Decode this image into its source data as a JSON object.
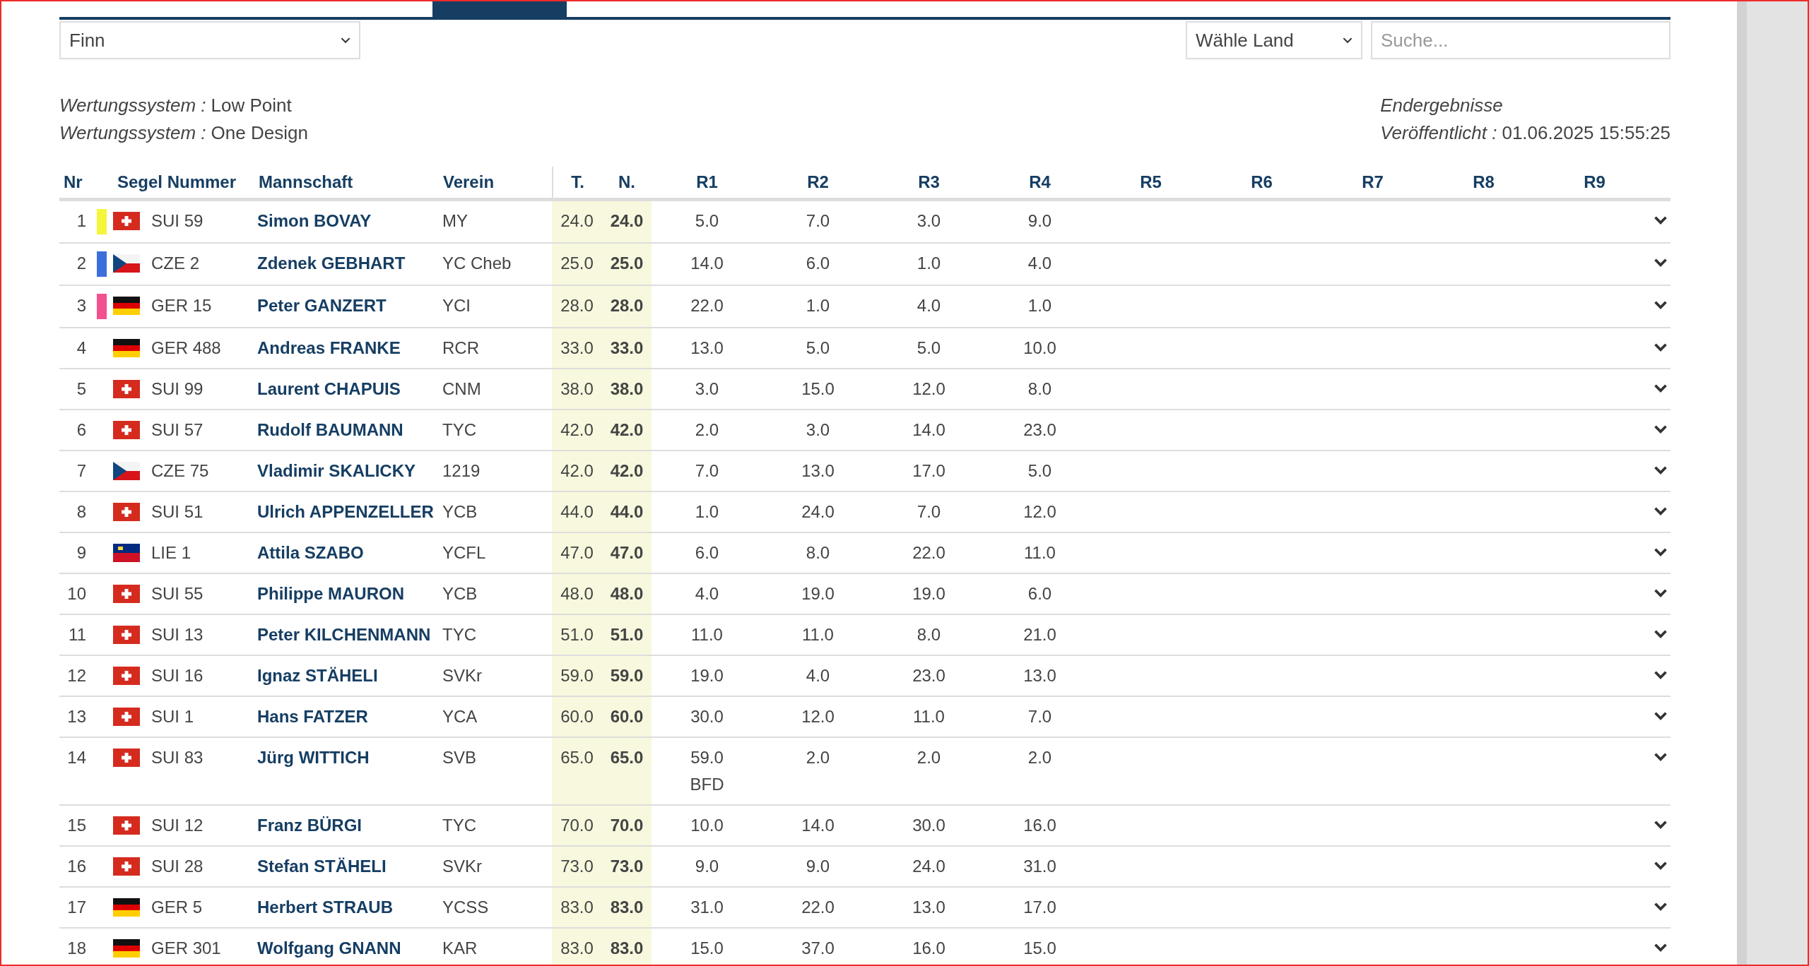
{
  "class_select": {
    "value": "Finn"
  },
  "country_select": {
    "value": "Wähle Land"
  },
  "search": {
    "placeholder": "Suche..."
  },
  "info_left": [
    {
      "label": "Wertungssystem :",
      "value": "Low Point"
    },
    {
      "label": "Wertungssystem :",
      "value": "One Design"
    }
  ],
  "info_right": {
    "status": "Endergebnisse",
    "published_label": "Veröffentlicht :",
    "published_value": "01.06.2025 15:55:25"
  },
  "table": {
    "columns": [
      "Nr",
      "Segel Nummer",
      "Mannschaft",
      "Verein",
      "T.",
      "N.",
      "R1",
      "R2",
      "R3",
      "R4",
      "R5",
      "R6",
      "R7",
      "R8",
      "R9"
    ],
    "rows": [
      {
        "nr": "1",
        "color": "#f5f53c",
        "flag": {
          "kind": "sui"
        },
        "sail": "SUI 59",
        "name": "Simon BOVAY",
        "club": "MY",
        "total": "24.0",
        "net": "24.0",
        "races": [
          {
            "score": "5.0"
          },
          {
            "score": "7.0"
          },
          {
            "score": "3.0"
          },
          {
            "score": "9.0"
          }
        ]
      },
      {
        "nr": "2",
        "color": "#3d6fdc",
        "flag": {
          "kind": "cze"
        },
        "sail": "CZE 2",
        "name": "Zdenek GEBHART",
        "club": "YC Cheb",
        "total": "25.0",
        "net": "25.0",
        "races": [
          {
            "score": "14.0"
          },
          {
            "score": "6.0"
          },
          {
            "score": "1.0"
          },
          {
            "score": "4.0"
          }
        ]
      },
      {
        "nr": "3",
        "color": "#f2508e",
        "flag": {
          "kind": "ger"
        },
        "sail": "GER 15",
        "name": "Peter GANZERT",
        "club": "YCI",
        "total": "28.0",
        "net": "28.0",
        "races": [
          {
            "score": "22.0"
          },
          {
            "score": "1.0"
          },
          {
            "score": "4.0"
          },
          {
            "score": "1.0"
          }
        ]
      },
      {
        "nr": "4",
        "flag": {
          "kind": "ger"
        },
        "sail": "GER 488",
        "name": "Andreas FRANKE",
        "club": "RCR",
        "total": "33.0",
        "net": "33.0",
        "races": [
          {
            "score": "13.0"
          },
          {
            "score": "5.0"
          },
          {
            "score": "5.0"
          },
          {
            "score": "10.0"
          }
        ]
      },
      {
        "nr": "5",
        "flag": {
          "kind": "sui"
        },
        "sail": "SUI 99",
        "name": "Laurent CHAPUIS",
        "club": "CNM",
        "total": "38.0",
        "net": "38.0",
        "races": [
          {
            "score": "3.0"
          },
          {
            "score": "15.0"
          },
          {
            "score": "12.0"
          },
          {
            "score": "8.0"
          }
        ]
      },
      {
        "nr": "6",
        "flag": {
          "kind": "sui"
        },
        "sail": "SUI 57",
        "name": "Rudolf BAUMANN",
        "club": "TYC",
        "total": "42.0",
        "net": "42.0",
        "races": [
          {
            "score": "2.0"
          },
          {
            "score": "3.0"
          },
          {
            "score": "14.0"
          },
          {
            "score": "23.0"
          }
        ]
      },
      {
        "nr": "7",
        "flag": {
          "kind": "cze"
        },
        "sail": "CZE 75",
        "name": "Vladimir SKALICKY",
        "club": "1219",
        "total": "42.0",
        "net": "42.0",
        "races": [
          {
            "score": "7.0"
          },
          {
            "score": "13.0"
          },
          {
            "score": "17.0"
          },
          {
            "score": "5.0"
          }
        ]
      },
      {
        "nr": "8",
        "flag": {
          "kind": "sui"
        },
        "sail": "SUI 51",
        "name": "Ulrich APPENZELLER",
        "club": "YCB",
        "total": "44.0",
        "net": "44.0",
        "races": [
          {
            "score": "1.0"
          },
          {
            "score": "24.0"
          },
          {
            "score": "7.0"
          },
          {
            "score": "12.0"
          }
        ]
      },
      {
        "nr": "9",
        "flag": {
          "kind": "lie"
        },
        "sail": "LIE 1",
        "name": "Attila SZABO",
        "club": "YCFL",
        "total": "47.0",
        "net": "47.0",
        "races": [
          {
            "score": "6.0"
          },
          {
            "score": "8.0"
          },
          {
            "score": "22.0"
          },
          {
            "score": "11.0"
          }
        ]
      },
      {
        "nr": "10",
        "flag": {
          "kind": "sui"
        },
        "sail": "SUI 55",
        "name": "Philippe MAURON",
        "club": "YCB",
        "total": "48.0",
        "net": "48.0",
        "races": [
          {
            "score": "4.0"
          },
          {
            "score": "19.0"
          },
          {
            "score": "19.0"
          },
          {
            "score": "6.0"
          }
        ]
      },
      {
        "nr": "11",
        "flag": {
          "kind": "sui"
        },
        "sail": "SUI 13",
        "name": "Peter KILCHENMANN",
        "club": "TYC",
        "total": "51.0",
        "net": "51.0",
        "races": [
          {
            "score": "11.0"
          },
          {
            "score": "11.0"
          },
          {
            "score": "8.0"
          },
          {
            "score": "21.0"
          }
        ]
      },
      {
        "nr": "12",
        "flag": {
          "kind": "sui"
        },
        "sail": "SUI 16",
        "name": "Ignaz STÄHELI",
        "club": "SVKr",
        "total": "59.0",
        "net": "59.0",
        "races": [
          {
            "score": "19.0"
          },
          {
            "score": "4.0"
          },
          {
            "score": "23.0"
          },
          {
            "score": "13.0"
          }
        ]
      },
      {
        "nr": "13",
        "flag": {
          "kind": "sui"
        },
        "sail": "SUI 1",
        "name": "Hans FATZER",
        "club": "YCA",
        "total": "60.0",
        "net": "60.0",
        "races": [
          {
            "score": "30.0"
          },
          {
            "score": "12.0"
          },
          {
            "score": "11.0"
          },
          {
            "score": "7.0"
          }
        ]
      },
      {
        "nr": "14",
        "flag": {
          "kind": "sui"
        },
        "sail": "SUI 83",
        "name": "Jürg WITTICH",
        "club": "SVB",
        "total": "65.0",
        "net": "65.0",
        "races": [
          {
            "score": "59.0",
            "code": "BFD"
          },
          {
            "score": "2.0"
          },
          {
            "score": "2.0"
          },
          {
            "score": "2.0"
          }
        ]
      },
      {
        "nr": "15",
        "flag": {
          "kind": "sui"
        },
        "sail": "SUI 12",
        "name": "Franz BÜRGI",
        "club": "TYC",
        "total": "70.0",
        "net": "70.0",
        "races": [
          {
            "score": "10.0"
          },
          {
            "score": "14.0"
          },
          {
            "score": "30.0"
          },
          {
            "score": "16.0"
          }
        ]
      },
      {
        "nr": "16",
        "flag": {
          "kind": "sui"
        },
        "sail": "SUI 28",
        "name": "Stefan STÄHELI",
        "club": "SVKr",
        "total": "73.0",
        "net": "73.0",
        "races": [
          {
            "score": "9.0"
          },
          {
            "score": "9.0"
          },
          {
            "score": "24.0"
          },
          {
            "score": "31.0"
          }
        ]
      },
      {
        "nr": "17",
        "flag": {
          "kind": "ger"
        },
        "sail": "GER 5",
        "name": "Herbert STRAUB",
        "club": "YCSS",
        "total": "83.0",
        "net": "83.0",
        "races": [
          {
            "score": "31.0"
          },
          {
            "score": "22.0"
          },
          {
            "score": "13.0"
          },
          {
            "score": "17.0"
          }
        ]
      },
      {
        "nr": "18",
        "flag": {
          "kind": "ger"
        },
        "sail": "GER 301",
        "name": "Wolfgang GNANN",
        "club": "KAR",
        "total": "83.0",
        "net": "83.0",
        "races": [
          {
            "score": "15.0"
          },
          {
            "score": "37.0"
          },
          {
            "score": "16.0"
          },
          {
            "score": "15.0"
          }
        ]
      }
    ]
  }
}
